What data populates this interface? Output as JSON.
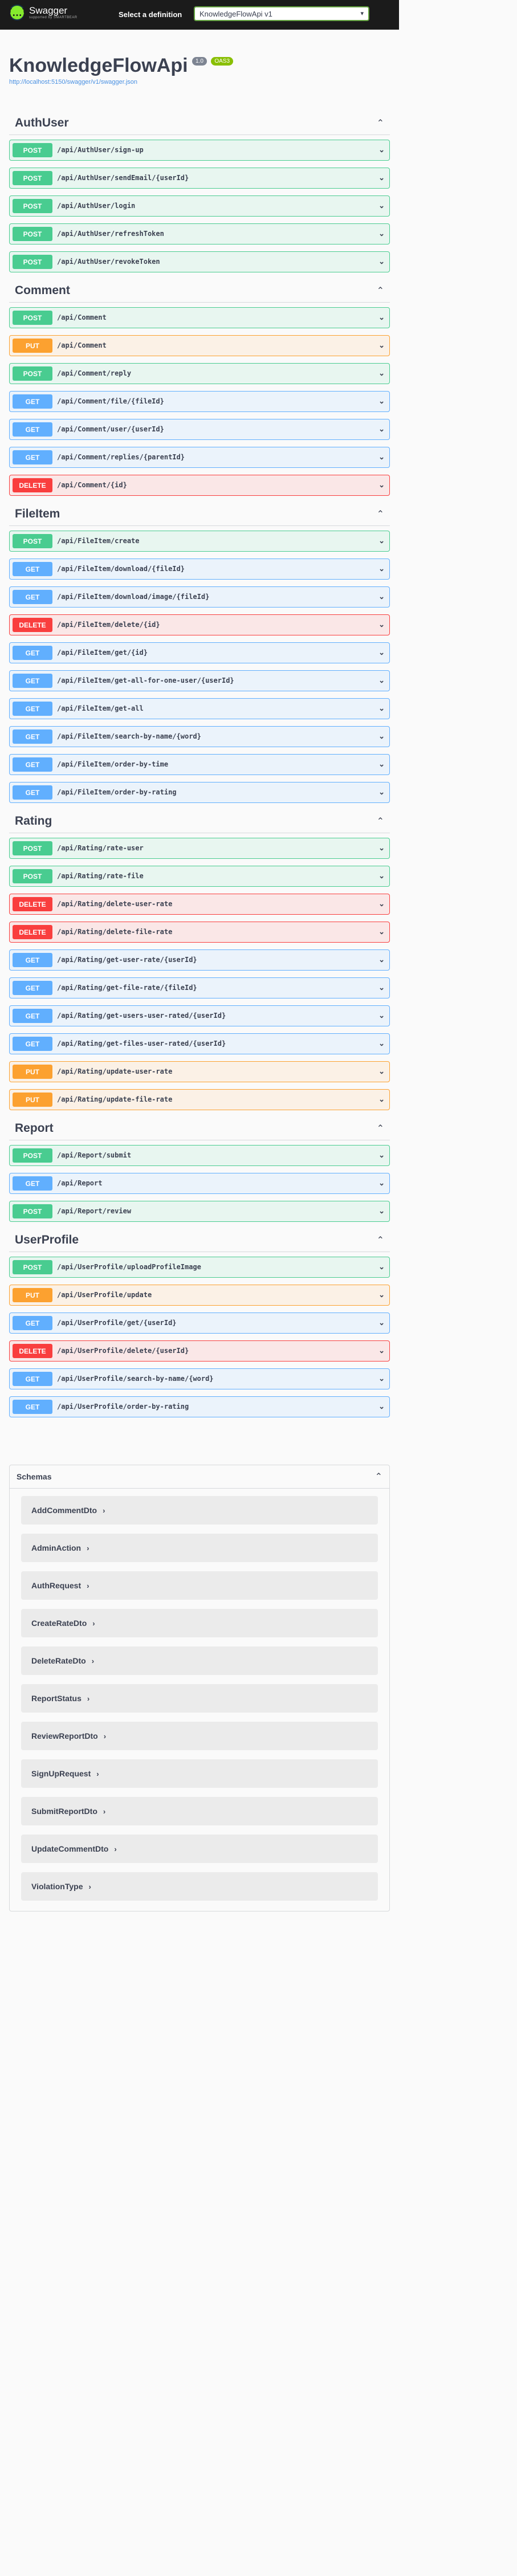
{
  "topbar": {
    "logo_mark": "{…}",
    "logo_name": "Swagger",
    "logo_sub": "supported by SMARTBEAR",
    "definition_label": "Select a definition",
    "definition_value": "KnowledgeFlowApi v1"
  },
  "info": {
    "title": "KnowledgeFlowApi",
    "version": "1.0",
    "oas": "OAS3",
    "url": "http://localhost:5150/swagger/v1/swagger.json"
  },
  "tags": [
    {
      "name": "AuthUser",
      "ops": [
        {
          "method": "POST",
          "path": "/api/AuthUser/sign-up"
        },
        {
          "method": "POST",
          "path": "/api/AuthUser/sendEmail/{userId}"
        },
        {
          "method": "POST",
          "path": "/api/AuthUser/login"
        },
        {
          "method": "POST",
          "path": "/api/AuthUser/refreshToken"
        },
        {
          "method": "POST",
          "path": "/api/AuthUser/revokeToken"
        }
      ]
    },
    {
      "name": "Comment",
      "ops": [
        {
          "method": "POST",
          "path": "/api/Comment"
        },
        {
          "method": "PUT",
          "path": "/api/Comment"
        },
        {
          "method": "POST",
          "path": "/api/Comment/reply"
        },
        {
          "method": "GET",
          "path": "/api/Comment/file/{fileId}"
        },
        {
          "method": "GET",
          "path": "/api/Comment/user/{userId}"
        },
        {
          "method": "GET",
          "path": "/api/Comment/replies/{parentId}"
        },
        {
          "method": "DELETE",
          "path": "/api/Comment/{id}"
        }
      ]
    },
    {
      "name": "FileItem",
      "ops": [
        {
          "method": "POST",
          "path": "/api/FileItem/create"
        },
        {
          "method": "GET",
          "path": "/api/FileItem/download/{fileId}"
        },
        {
          "method": "GET",
          "path": "/api/FileItem/download/image/{fileId}"
        },
        {
          "method": "DELETE",
          "path": "/api/FileItem/delete/{id}"
        },
        {
          "method": "GET",
          "path": "/api/FileItem/get/{id}"
        },
        {
          "method": "GET",
          "path": "/api/FileItem/get-all-for-one-user/{userId}"
        },
        {
          "method": "GET",
          "path": "/api/FileItem/get-all"
        },
        {
          "method": "GET",
          "path": "/api/FileItem/search-by-name/{word}"
        },
        {
          "method": "GET",
          "path": "/api/FileItem/order-by-time"
        },
        {
          "method": "GET",
          "path": "/api/FileItem/order-by-rating"
        }
      ]
    },
    {
      "name": "Rating",
      "ops": [
        {
          "method": "POST",
          "path": "/api/Rating/rate-user"
        },
        {
          "method": "POST",
          "path": "/api/Rating/rate-file"
        },
        {
          "method": "DELETE",
          "path": "/api/Rating/delete-user-rate"
        },
        {
          "method": "DELETE",
          "path": "/api/Rating/delete-file-rate"
        },
        {
          "method": "GET",
          "path": "/api/Rating/get-user-rate/{userId}"
        },
        {
          "method": "GET",
          "path": "/api/Rating/get-file-rate/{fileId}"
        },
        {
          "method": "GET",
          "path": "/api/Rating/get-users-user-rated/{userId}"
        },
        {
          "method": "GET",
          "path": "/api/Rating/get-files-user-rated/{userId}"
        },
        {
          "method": "PUT",
          "path": "/api/Rating/update-user-rate"
        },
        {
          "method": "PUT",
          "path": "/api/Rating/update-file-rate"
        }
      ]
    },
    {
      "name": "Report",
      "ops": [
        {
          "method": "POST",
          "path": "/api/Report/submit"
        },
        {
          "method": "GET",
          "path": "/api/Report"
        },
        {
          "method": "POST",
          "path": "/api/Report/review"
        }
      ]
    },
    {
      "name": "UserProfile",
      "ops": [
        {
          "method": "POST",
          "path": "/api/UserProfile/uploadProfileImage"
        },
        {
          "method": "PUT",
          "path": "/api/UserProfile/update"
        },
        {
          "method": "GET",
          "path": "/api/UserProfile/get/{userId}"
        },
        {
          "method": "DELETE",
          "path": "/api/UserProfile/delete/{userId}"
        },
        {
          "method": "GET",
          "path": "/api/UserProfile/search-by-name/{word}"
        },
        {
          "method": "GET",
          "path": "/api/UserProfile/order-by-rating"
        }
      ]
    }
  ],
  "schemas": {
    "title": "Schemas",
    "items": [
      "AddCommentDto",
      "AdminAction",
      "AuthRequest",
      "CreateRateDto",
      "DeleteRateDto",
      "ReportStatus",
      "ReviewReportDto",
      "SignUpRequest",
      "SubmitReportDto",
      "UpdateCommentDto",
      "ViolationType"
    ]
  },
  "colors": {
    "post": "#49cc90",
    "get": "#61affe",
    "put": "#fca130",
    "delete": "#f93e3e",
    "topbar": "#1b1b1b"
  },
  "icons": {
    "expand": "chevron-down-icon",
    "collapse": "chevron-up-icon",
    "schema": "chevron-right-icon"
  }
}
